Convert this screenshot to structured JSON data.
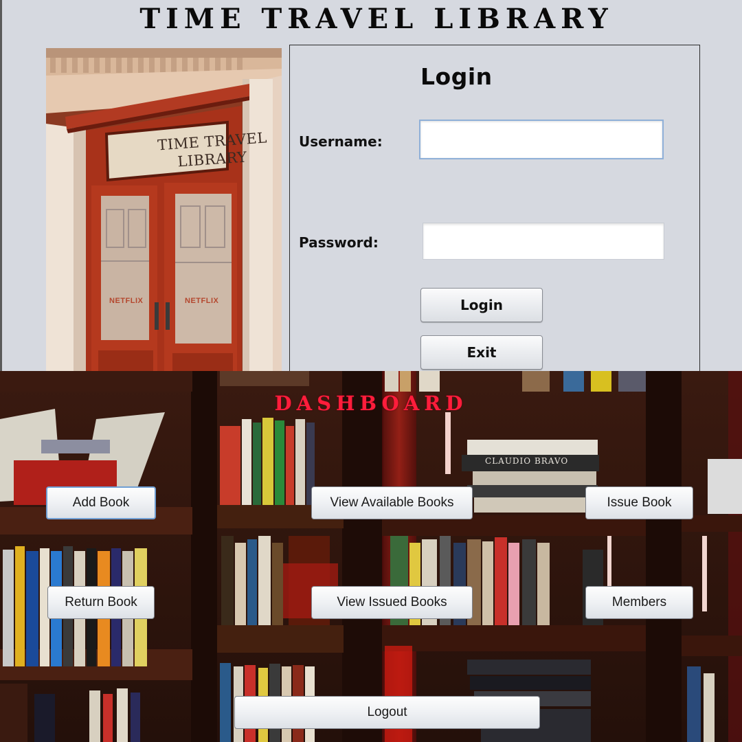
{
  "login": {
    "app_title": "TIME TRAVEL LIBRARY",
    "photo": {
      "sign_line1": "TIME TRAVEL",
      "sign_line2": "LIBRARY",
      "door_text_left": "NETFLIX",
      "door_text_right": "NETFLIX"
    },
    "heading": "Login",
    "username_label": "Username:",
    "username_value": "",
    "password_label": "Password:",
    "password_value": "",
    "login_button": "Login",
    "exit_button": "Exit"
  },
  "dashboard": {
    "title": "DASHBOARD",
    "book_spine_text": "CLAUDIO BRAVO",
    "buttons": {
      "add_book": "Add Book",
      "view_available_books": "View Available Books",
      "issue_book": "Issue Book",
      "return_book": "Return Book",
      "view_issued_books": "View Issued Books",
      "members": "Members",
      "logout": "Logout"
    }
  },
  "colors": {
    "window_bg": "#d6d9e0",
    "dashboard_title": "#ff1d3b",
    "door_red": "#a8321a",
    "focus_border": "#6f9fd4"
  }
}
